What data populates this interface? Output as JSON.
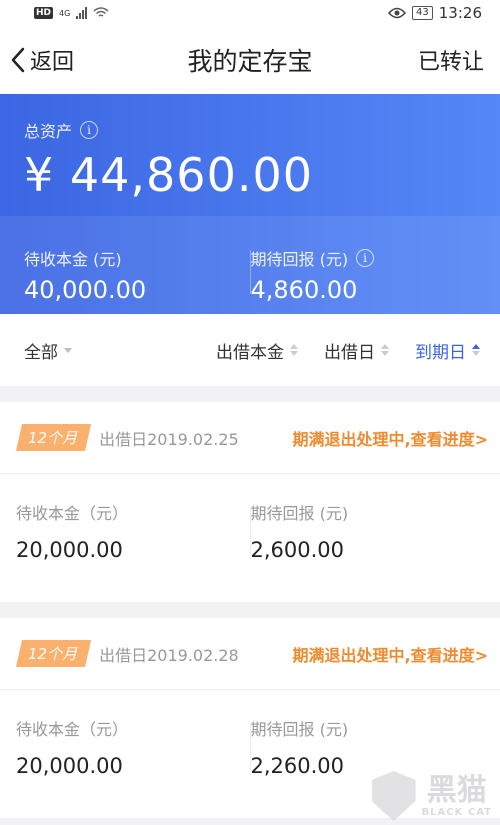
{
  "status_bar": {
    "hd": "HD",
    "network": "4G",
    "battery": "43",
    "time": "13:26"
  },
  "nav": {
    "back_label": "返回",
    "title": "我的定存宝",
    "right_label": "已转让"
  },
  "summary": {
    "total_label": "总资产",
    "total_value": "¥ 44,860.00",
    "principal_label": "待收本金 (元)",
    "principal_value": "40,000.00",
    "return_label": "期待回报 (元)",
    "return_value": "4,860.00"
  },
  "filter": {
    "all_label": "全部",
    "sort_principal": "出借本金",
    "sort_lend_date": "出借日",
    "sort_due_date": "到期日",
    "active_sort": "到期日"
  },
  "cards": [
    {
      "term": "12个月",
      "lend_date": "出借日2019.02.25",
      "status": "期满退出处理中,查看进度>",
      "principal_label": "待收本金（元）",
      "principal_value": "20,000.00",
      "return_label": "期待回报 (元)",
      "return_value": "2,600.00"
    },
    {
      "term": "12个月",
      "lend_date": "出借日2019.02.28",
      "status": "期满退出处理中,查看进度>",
      "principal_label": "待收本金（元）",
      "principal_value": "20,000.00",
      "return_label": "期待回报 (元)",
      "return_value": "2,260.00"
    }
  ],
  "watermark": {
    "cn": "黑猫",
    "en": "BLACK CAT"
  },
  "colors": {
    "hero_start": "#3c66e3",
    "hero_end": "#5587f6",
    "accent_blue": "#3b66e0",
    "status_orange": "#f08a2c",
    "tag_orange": "#fbb06d"
  }
}
